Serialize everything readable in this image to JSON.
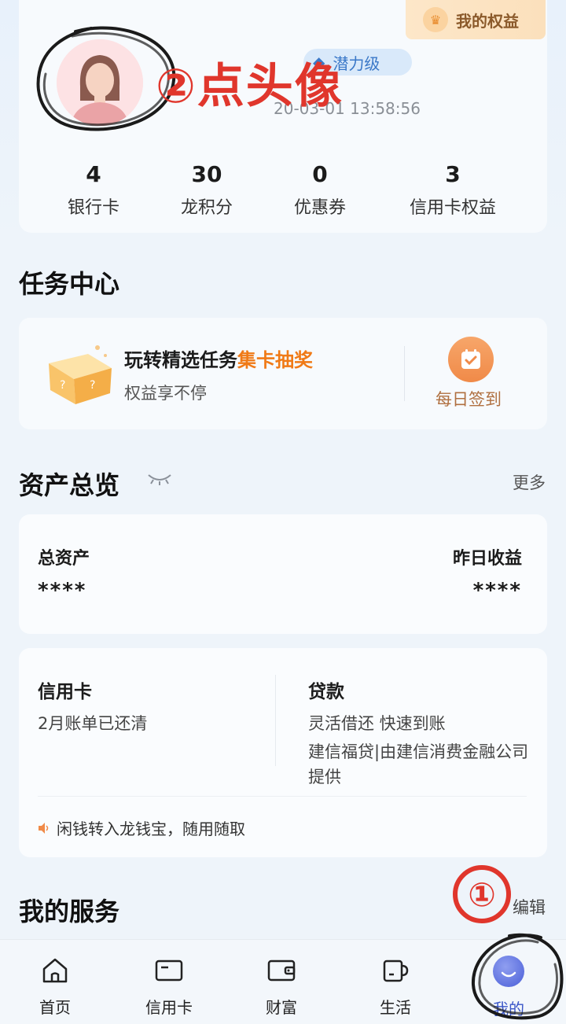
{
  "profile": {
    "rights_label": "我的权益",
    "level_label": "潜力级",
    "login_time": "20-03-01 13:58:56",
    "annotation_avatar": "②点头像",
    "stats": [
      {
        "value": "4",
        "label": "银行卡"
      },
      {
        "value": "30",
        "label": "龙积分"
      },
      {
        "value": "0",
        "label": "优惠券"
      },
      {
        "value": "3",
        "label": "信用卡权益"
      }
    ]
  },
  "task_center": {
    "title": "任务中心",
    "card_title_prefix": "玩转精选任务",
    "card_title_highlight": "集卡抽奖",
    "card_subtitle": "权益享不停",
    "checkin_label": "每日签到"
  },
  "assets": {
    "title": "资产总览",
    "more": "更多",
    "total_label": "总资产",
    "total_value": "****",
    "yesterday_label": "昨日收益",
    "yesterday_value": "****"
  },
  "credit": {
    "card_title": "信用卡",
    "card_status": "2月账单已还清",
    "loan_title": "贷款",
    "loan_line1": "灵活借还 快速到账",
    "loan_line2": "建信福贷|由建信消费金融公司提供",
    "notice": "闲钱转入龙钱宝，随用随取"
  },
  "services": {
    "title": "我的服务",
    "edit": "编辑",
    "annotation_step": "①"
  },
  "nav": [
    {
      "label": "首页",
      "icon": "home-icon"
    },
    {
      "label": "信用卡",
      "icon": "credit-card-icon"
    },
    {
      "label": "财富",
      "icon": "wallet-icon"
    },
    {
      "label": "生活",
      "icon": "cup-icon"
    },
    {
      "label": "我的",
      "icon": "me-icon"
    }
  ],
  "colors": {
    "accent_orange": "#f07a16",
    "annotation_red": "#e0362c",
    "active_blue": "#3a56c8"
  }
}
